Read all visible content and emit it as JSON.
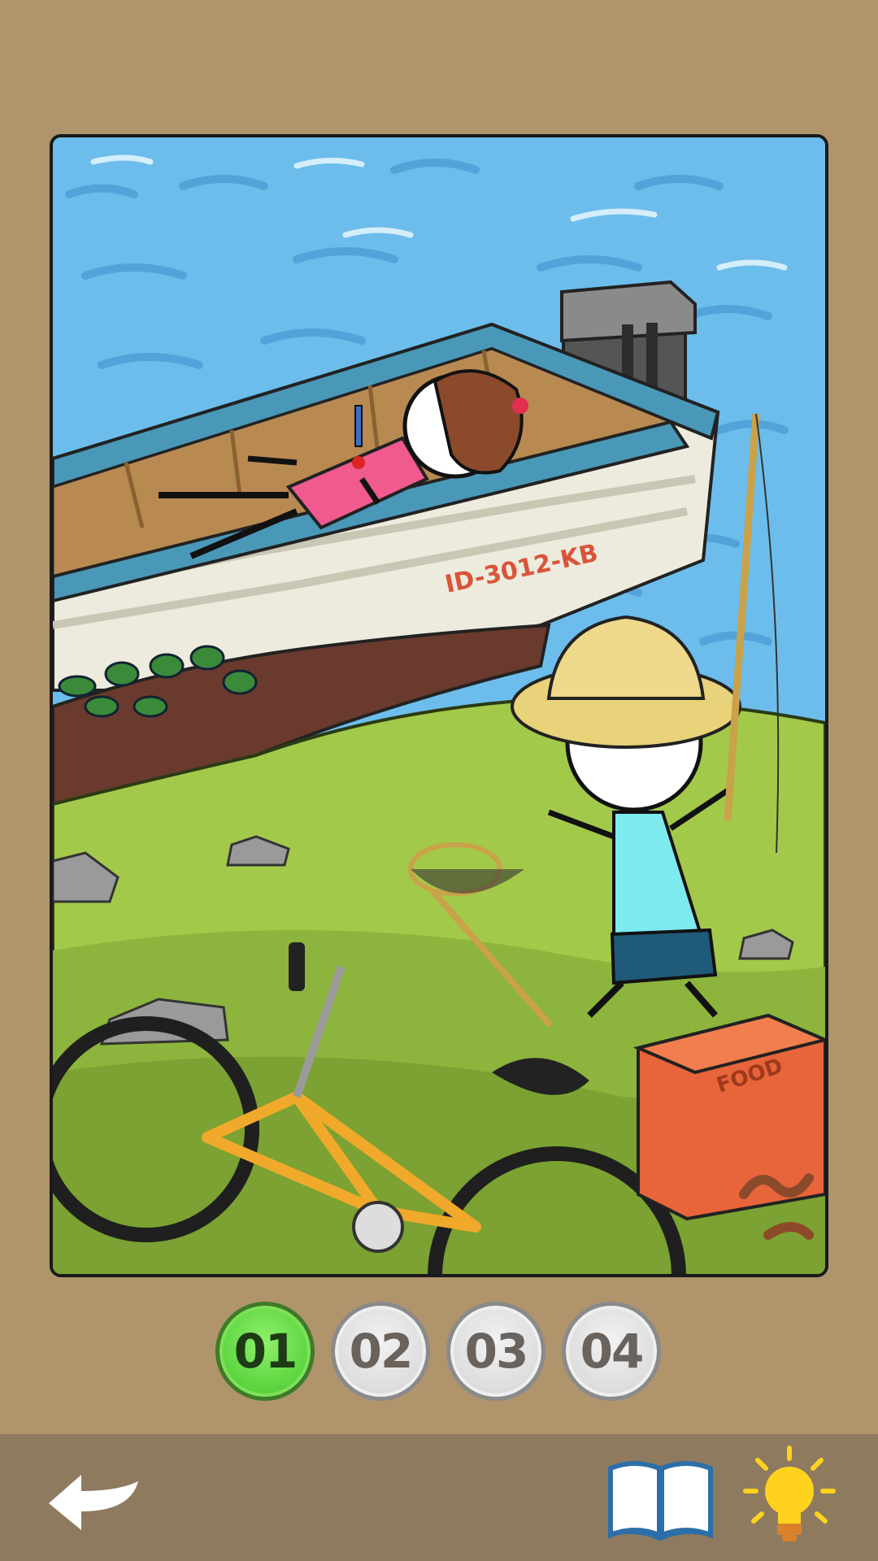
{
  "scene": {
    "boat_id": "ID-3012-KB",
    "crate_label": "FOOD",
    "icons": [
      "knife-icon",
      "fish-icon"
    ]
  },
  "levels": [
    {
      "label": "01",
      "active": true
    },
    {
      "label": "02",
      "active": false
    },
    {
      "label": "03",
      "active": false
    },
    {
      "label": "04",
      "active": false
    }
  ],
  "toolbar": {
    "back_icon": "back-arrow-icon",
    "book_icon": "open-book-icon",
    "hint_icon": "lightbulb-icon"
  },
  "colors": {
    "background": "#B0946C",
    "bottom_bar": "#8E7A5E",
    "active_level": "#55D13A",
    "inactive_level": "#DCDCDC",
    "hint_bulb": "#FFD21E"
  }
}
